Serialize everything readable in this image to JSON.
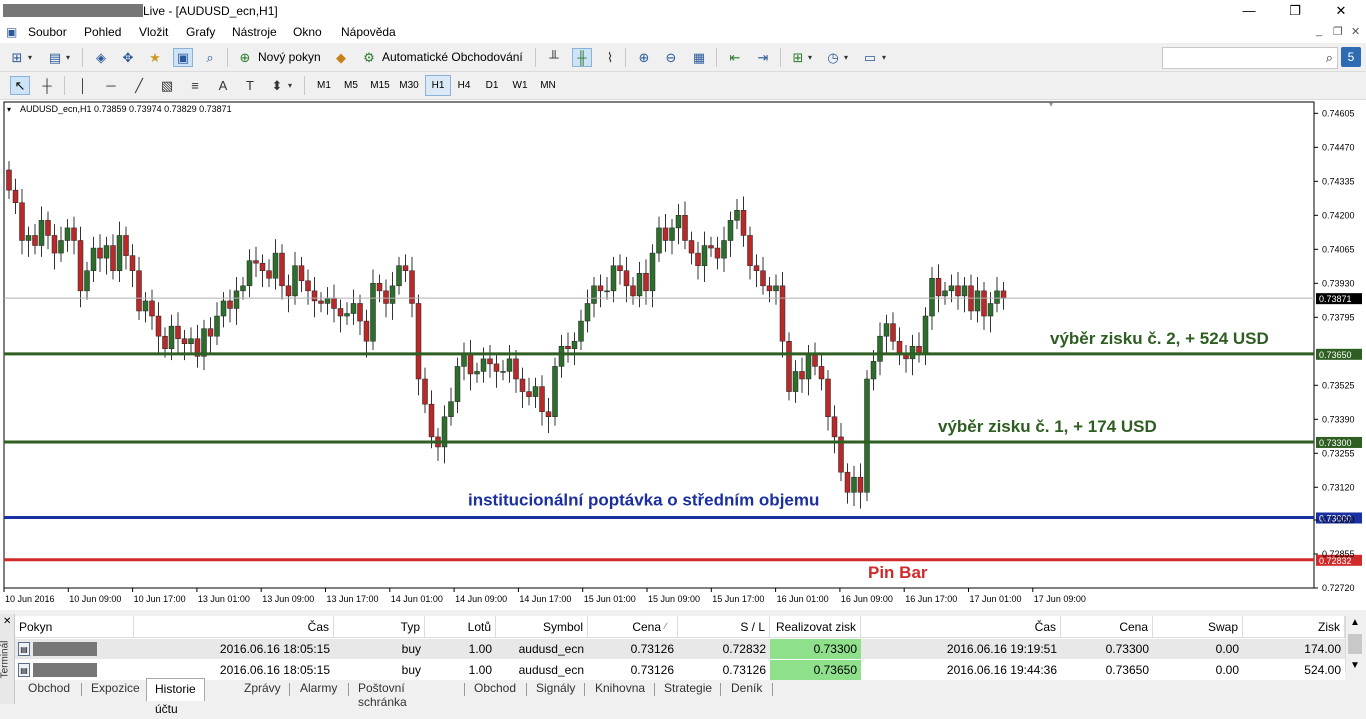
{
  "window": {
    "title": "Live - [AUDUSD_ecn,H1]"
  },
  "menu": [
    "Soubor",
    "Pohled",
    "Vložit",
    "Grafy",
    "Nástroje",
    "Okno",
    "Nápověda"
  ],
  "toolbar": {
    "new_order": "Nový pokyn",
    "auto_trading": "Automatické Obchodování"
  },
  "timeframes": [
    "M1",
    "M5",
    "M15",
    "M30",
    "H1",
    "H4",
    "D1",
    "W1",
    "MN"
  ],
  "selected_timeframe": "H1",
  "chart_data": {
    "type": "candlestick",
    "title": "AUDUSD_ecn,H1  0.73859 0.73974 0.73829 0.73871",
    "ylim": [
      0.7272,
      0.7465
    ],
    "y_ticks": [
      "0.74605",
      "0.74470",
      "0.74335",
      "0.74200",
      "0.74065",
      "0.73930",
      "0.73795",
      "0.73525",
      "0.73390",
      "0.73255",
      "0.73120",
      "0.72990",
      "0.72855",
      "0.72720"
    ],
    "x_ticks": [
      "10 Jun 2016",
      "10 Jun 09:00",
      "10 Jun 17:00",
      "13 Jun 01:00",
      "13 Jun 09:00",
      "13 Jun 17:00",
      "14 Jun 01:00",
      "14 Jun 09:00",
      "14 Jun 17:00",
      "15 Jun 01:00",
      "15 Jun 09:00",
      "15 Jun 17:00",
      "16 Jun 01:00",
      "16 Jun 09:00",
      "16 Jun 17:00",
      "17 Jun 01:00",
      "17 Jun 09:00"
    ],
    "current_price": {
      "label": "0.73871",
      "value": 0.73871
    },
    "levels": [
      {
        "label": "0.73650",
        "value": 0.7365,
        "color": "#2e5e22",
        "annotation": "výběr zisku č. 2, + 524 USD"
      },
      {
        "label": "0.73300",
        "value": 0.733,
        "color": "#2e5e22",
        "annotation": "výběr zisku č. 1, + 174 USD"
      },
      {
        "label": "0.73000",
        "value": 0.73,
        "color": "#1a2fa0",
        "annotation": "institucionální poptávka o středním objemu"
      },
      {
        "label": "0.72832",
        "value": 0.72832,
        "color": "#d02a2a",
        "annotation": "Pin Bar"
      }
    ],
    "bull_color": "#2d6e2d",
    "bear_color": "#b82a2a",
    "closes": [
      0.743,
      0.7425,
      0.741,
      0.7412,
      0.7408,
      0.7418,
      0.7412,
      0.7405,
      0.741,
      0.7415,
      0.741,
      0.739,
      0.7398,
      0.7407,
      0.7403,
      0.7408,
      0.7398,
      0.7412,
      0.7404,
      0.7398,
      0.7382,
      0.7386,
      0.738,
      0.7372,
      0.7367,
      0.7376,
      0.7371,
      0.7369,
      0.7371,
      0.7364,
      0.7375,
      0.7372,
      0.738,
      0.7386,
      0.7383,
      0.739,
      0.7392,
      0.7402,
      0.7401,
      0.7398,
      0.7395,
      0.7405,
      0.7392,
      0.7388,
      0.74,
      0.7394,
      0.739,
      0.7386,
      0.7385,
      0.7387,
      0.7383,
      0.738,
      0.7381,
      0.7385,
      0.7378,
      0.737,
      0.7393,
      0.739,
      0.7385,
      0.7392,
      0.74,
      0.7398,
      0.7385,
      0.7355,
      0.7345,
      0.7332,
      0.7328,
      0.734,
      0.7346,
      0.736,
      0.7365,
      0.7357,
      0.7358,
      0.7363,
      0.7361,
      0.7358,
      0.7358,
      0.7363,
      0.7355,
      0.735,
      0.7348,
      0.7352,
      0.7342,
      0.734,
      0.736,
      0.7368,
      0.7367,
      0.737,
      0.7378,
      0.7385,
      0.7392,
      0.739,
      0.739,
      0.74,
      0.7398,
      0.7392,
      0.7388,
      0.7397,
      0.739,
      0.7405,
      0.7415,
      0.741,
      0.7415,
      0.742,
      0.741,
      0.7405,
      0.74,
      0.7408,
      0.7407,
      0.7403,
      0.741,
      0.7418,
      0.7422,
      0.7412,
      0.74,
      0.7398,
      0.7392,
      0.739,
      0.7392,
      0.737,
      0.735,
      0.7358,
      0.7355,
      0.7365,
      0.736,
      0.7355,
      0.734,
      0.7332,
      0.7318,
      0.731,
      0.7316,
      0.731,
      0.7355,
      0.7362,
      0.7372,
      0.7377,
      0.737,
      0.7365,
      0.7363,
      0.7368,
      0.7365,
      0.738,
      0.7395,
      0.7388,
      0.739,
      0.7392,
      0.7388,
      0.7392,
      0.7382,
      0.739,
      0.738,
      0.7385,
      0.739,
      0.7387
    ]
  },
  "terminal": {
    "label": "Terminál",
    "columns": [
      "Pokyn",
      "Čas",
      "Typ",
      "Lotů",
      "Symbol",
      "Cena",
      "S / L",
      "Realizovat zisk",
      "Čas",
      "Cena",
      "Swap",
      "Zisk"
    ],
    "rows": [
      {
        "time": "2016.06.16 18:05:15",
        "type": "buy",
        "lots": "1.00",
        "symbol": "audusd_ecn",
        "price": "0.73126",
        "sl": "0.72832",
        "tp": "0.73300",
        "close_time": "2016.06.16 19:19:51",
        "close_price": "0.73300",
        "swap": "0.00",
        "profit": "174.00"
      },
      {
        "time": "2016.06.16 18:05:15",
        "type": "buy",
        "lots": "1.00",
        "symbol": "audusd_ecn",
        "price": "0.73126",
        "sl": "0.73126",
        "tp": "0.73650",
        "close_time": "2016.06.16 19:44:36",
        "close_price": "0.73650",
        "swap": "0.00",
        "profit": "524.00"
      }
    ],
    "tabs": [
      "Obchod",
      "Expozice",
      "Historie účtu",
      "Zprávy",
      "Alarmy",
      "Poštovní schránka",
      "Obchod",
      "Signály",
      "Knihovna",
      "Strategie",
      "Deník"
    ],
    "active_tab": "Historie účtu"
  }
}
